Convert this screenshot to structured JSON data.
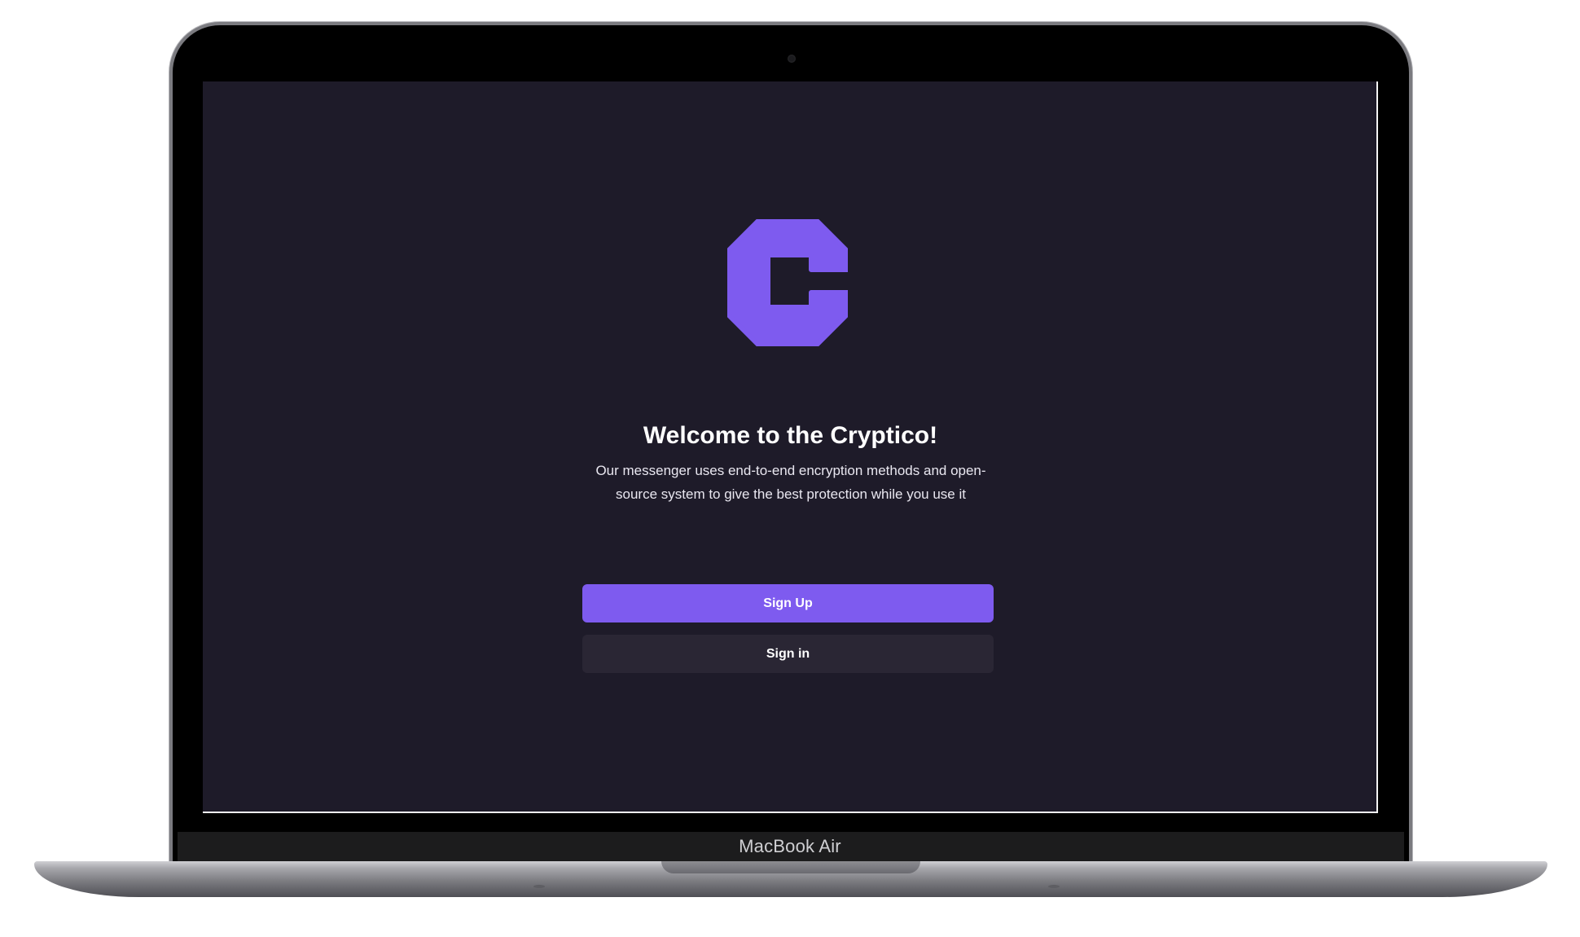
{
  "device": {
    "label": "MacBook Air"
  },
  "app": {
    "logo_icon": "cryptico-logo-icon",
    "logo_color": "#7E5BEF",
    "background_color": "#1E1B29",
    "title": "Welcome to the Cryptico!",
    "subtitle": "Our messenger uses end-to-end encryption methods and open-source system to give the best protection while you use it",
    "sign_up_label": "Sign Up",
    "sign_in_label": "Sign in"
  }
}
